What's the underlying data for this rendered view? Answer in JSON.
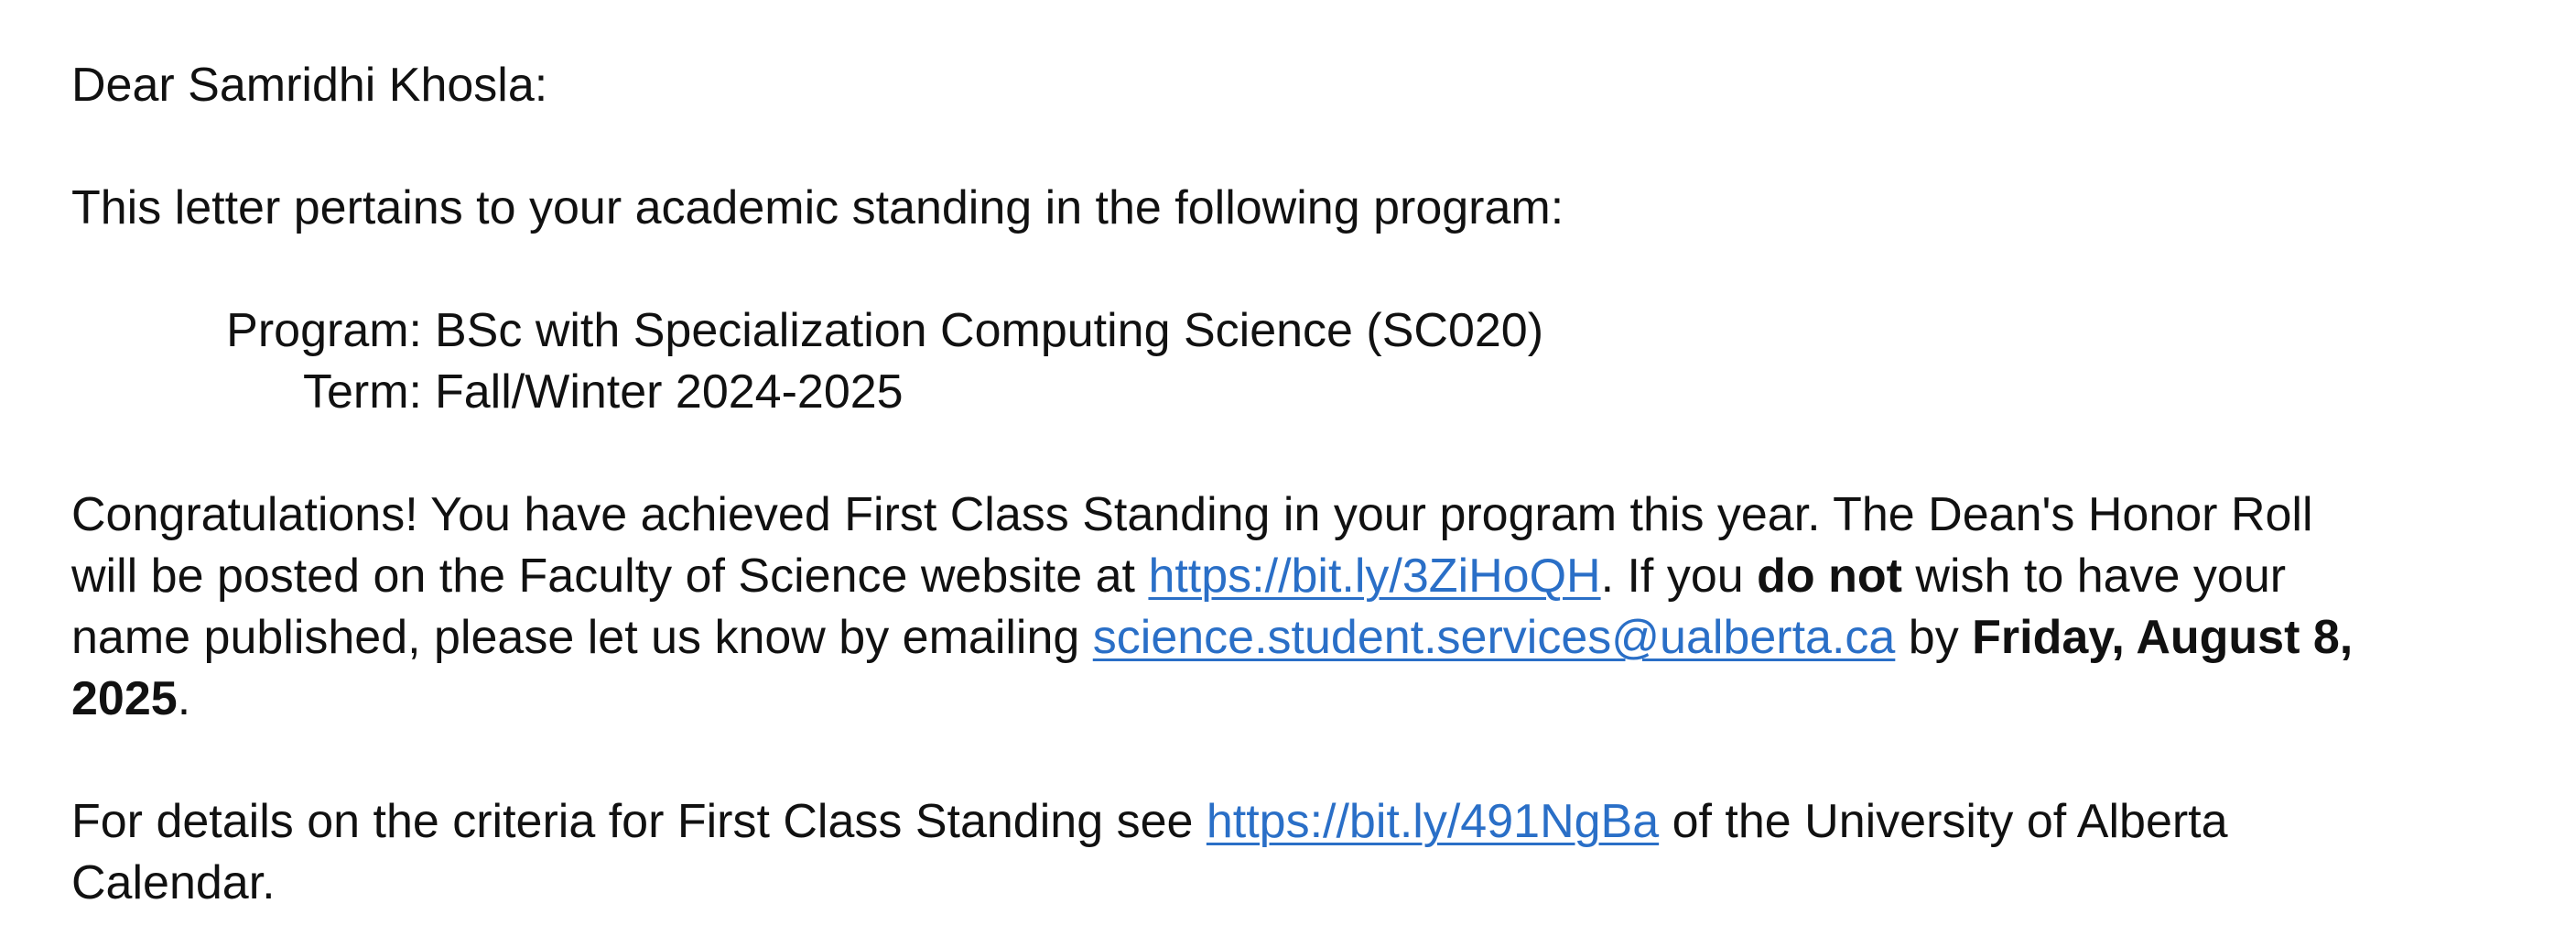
{
  "greeting": "Dear Samridhi Khosla:",
  "intro": "This letter pertains to your academic standing in the following program:",
  "program": {
    "label": "Program:",
    "value": "BSc with Specialization Computing Science (SC020)"
  },
  "term": {
    "label": "Term:",
    "value": "Fall/Winter 2024-2025"
  },
  "congrats": {
    "line1": "Congratulations!  You have achieved First Class Standing in your program this year.  The Dean's Honor Roll",
    "line2_prefix": "will be posted on the Faculty of Science website at ",
    "honor_roll_link": "https://bit.ly/3ZiHoQH",
    "line2_mid": ". If you ",
    "do_not": "do not",
    "line2_suffix": " wish to have your",
    "line3_prefix": "name published, please let us know by emailing ",
    "email_link": "science.student.services@ualberta.ca",
    "line3_mid": " by ",
    "deadline_part1": "Friday, August 8,",
    "deadline_part2": "2025",
    "line4_suffix": "."
  },
  "details": {
    "line1_prefix": "For details on the criteria for First Class Standing see ",
    "criteria_link": "https://bit.ly/491NgBa",
    "line1_suffix": " of the University of Alberta",
    "line2": "Calendar."
  }
}
